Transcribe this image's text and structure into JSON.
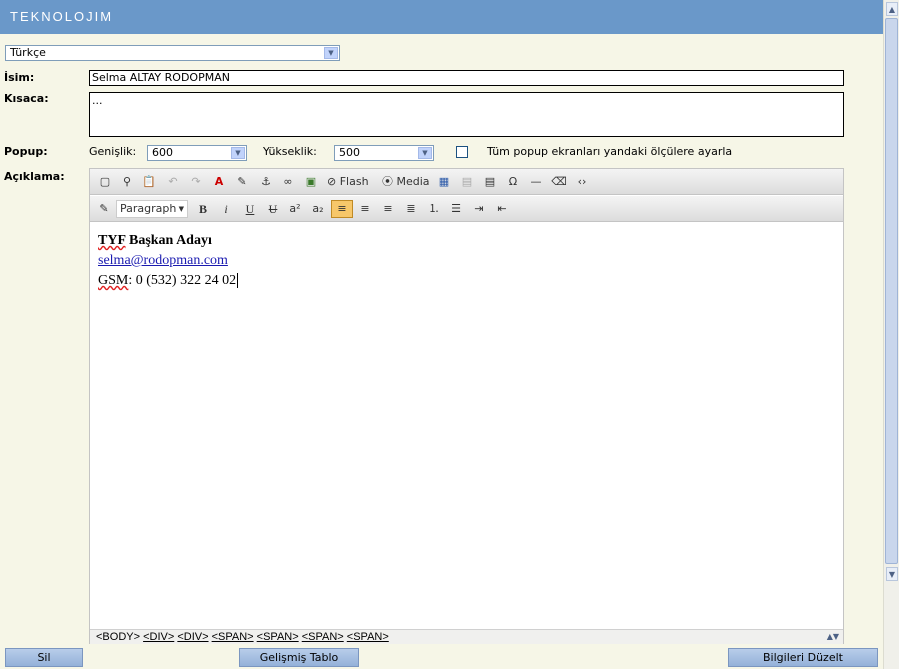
{
  "header": {
    "logo": "TEKNOLOJIM"
  },
  "language": {
    "selected": "Türkçe"
  },
  "form": {
    "name_label": "İsim:",
    "name_value": "Selma ALTAY RODOPMAN",
    "summary_label": "Kısaca:",
    "summary_value": "...",
    "popup_label": "Popup:",
    "width_label": "Genişlik:",
    "width_value": "600",
    "height_label": "Yükseklik:",
    "height_value": "500",
    "resize_all_label": "Tüm popup ekranları yandaki ölçülere ayarla",
    "desc_label": "Açıklama:"
  },
  "editor": {
    "toolbar1": {
      "flash_label": "Flash",
      "media_label": "Media"
    },
    "toolbar2": {
      "format_value": "Paragraph"
    },
    "content": {
      "line1": "TYF Başkan Adayı",
      "line1_word": "TYF",
      "line1_rest": " Başkan Adayı",
      "line2": "selma@rodopman.com",
      "line3_label": "GSM",
      "line3_value": ": 0 (532) 322 24 02"
    },
    "path": [
      "<BODY>",
      "<DIV>",
      "<DIV>",
      "<SPAN>",
      "<SPAN>",
      "<SPAN>",
      "<SPAN>"
    ]
  },
  "buttons": {
    "delete": "Sil",
    "advanced_table": "Gelişmiş Tablo",
    "update": "Bilgileri Düzelt"
  }
}
